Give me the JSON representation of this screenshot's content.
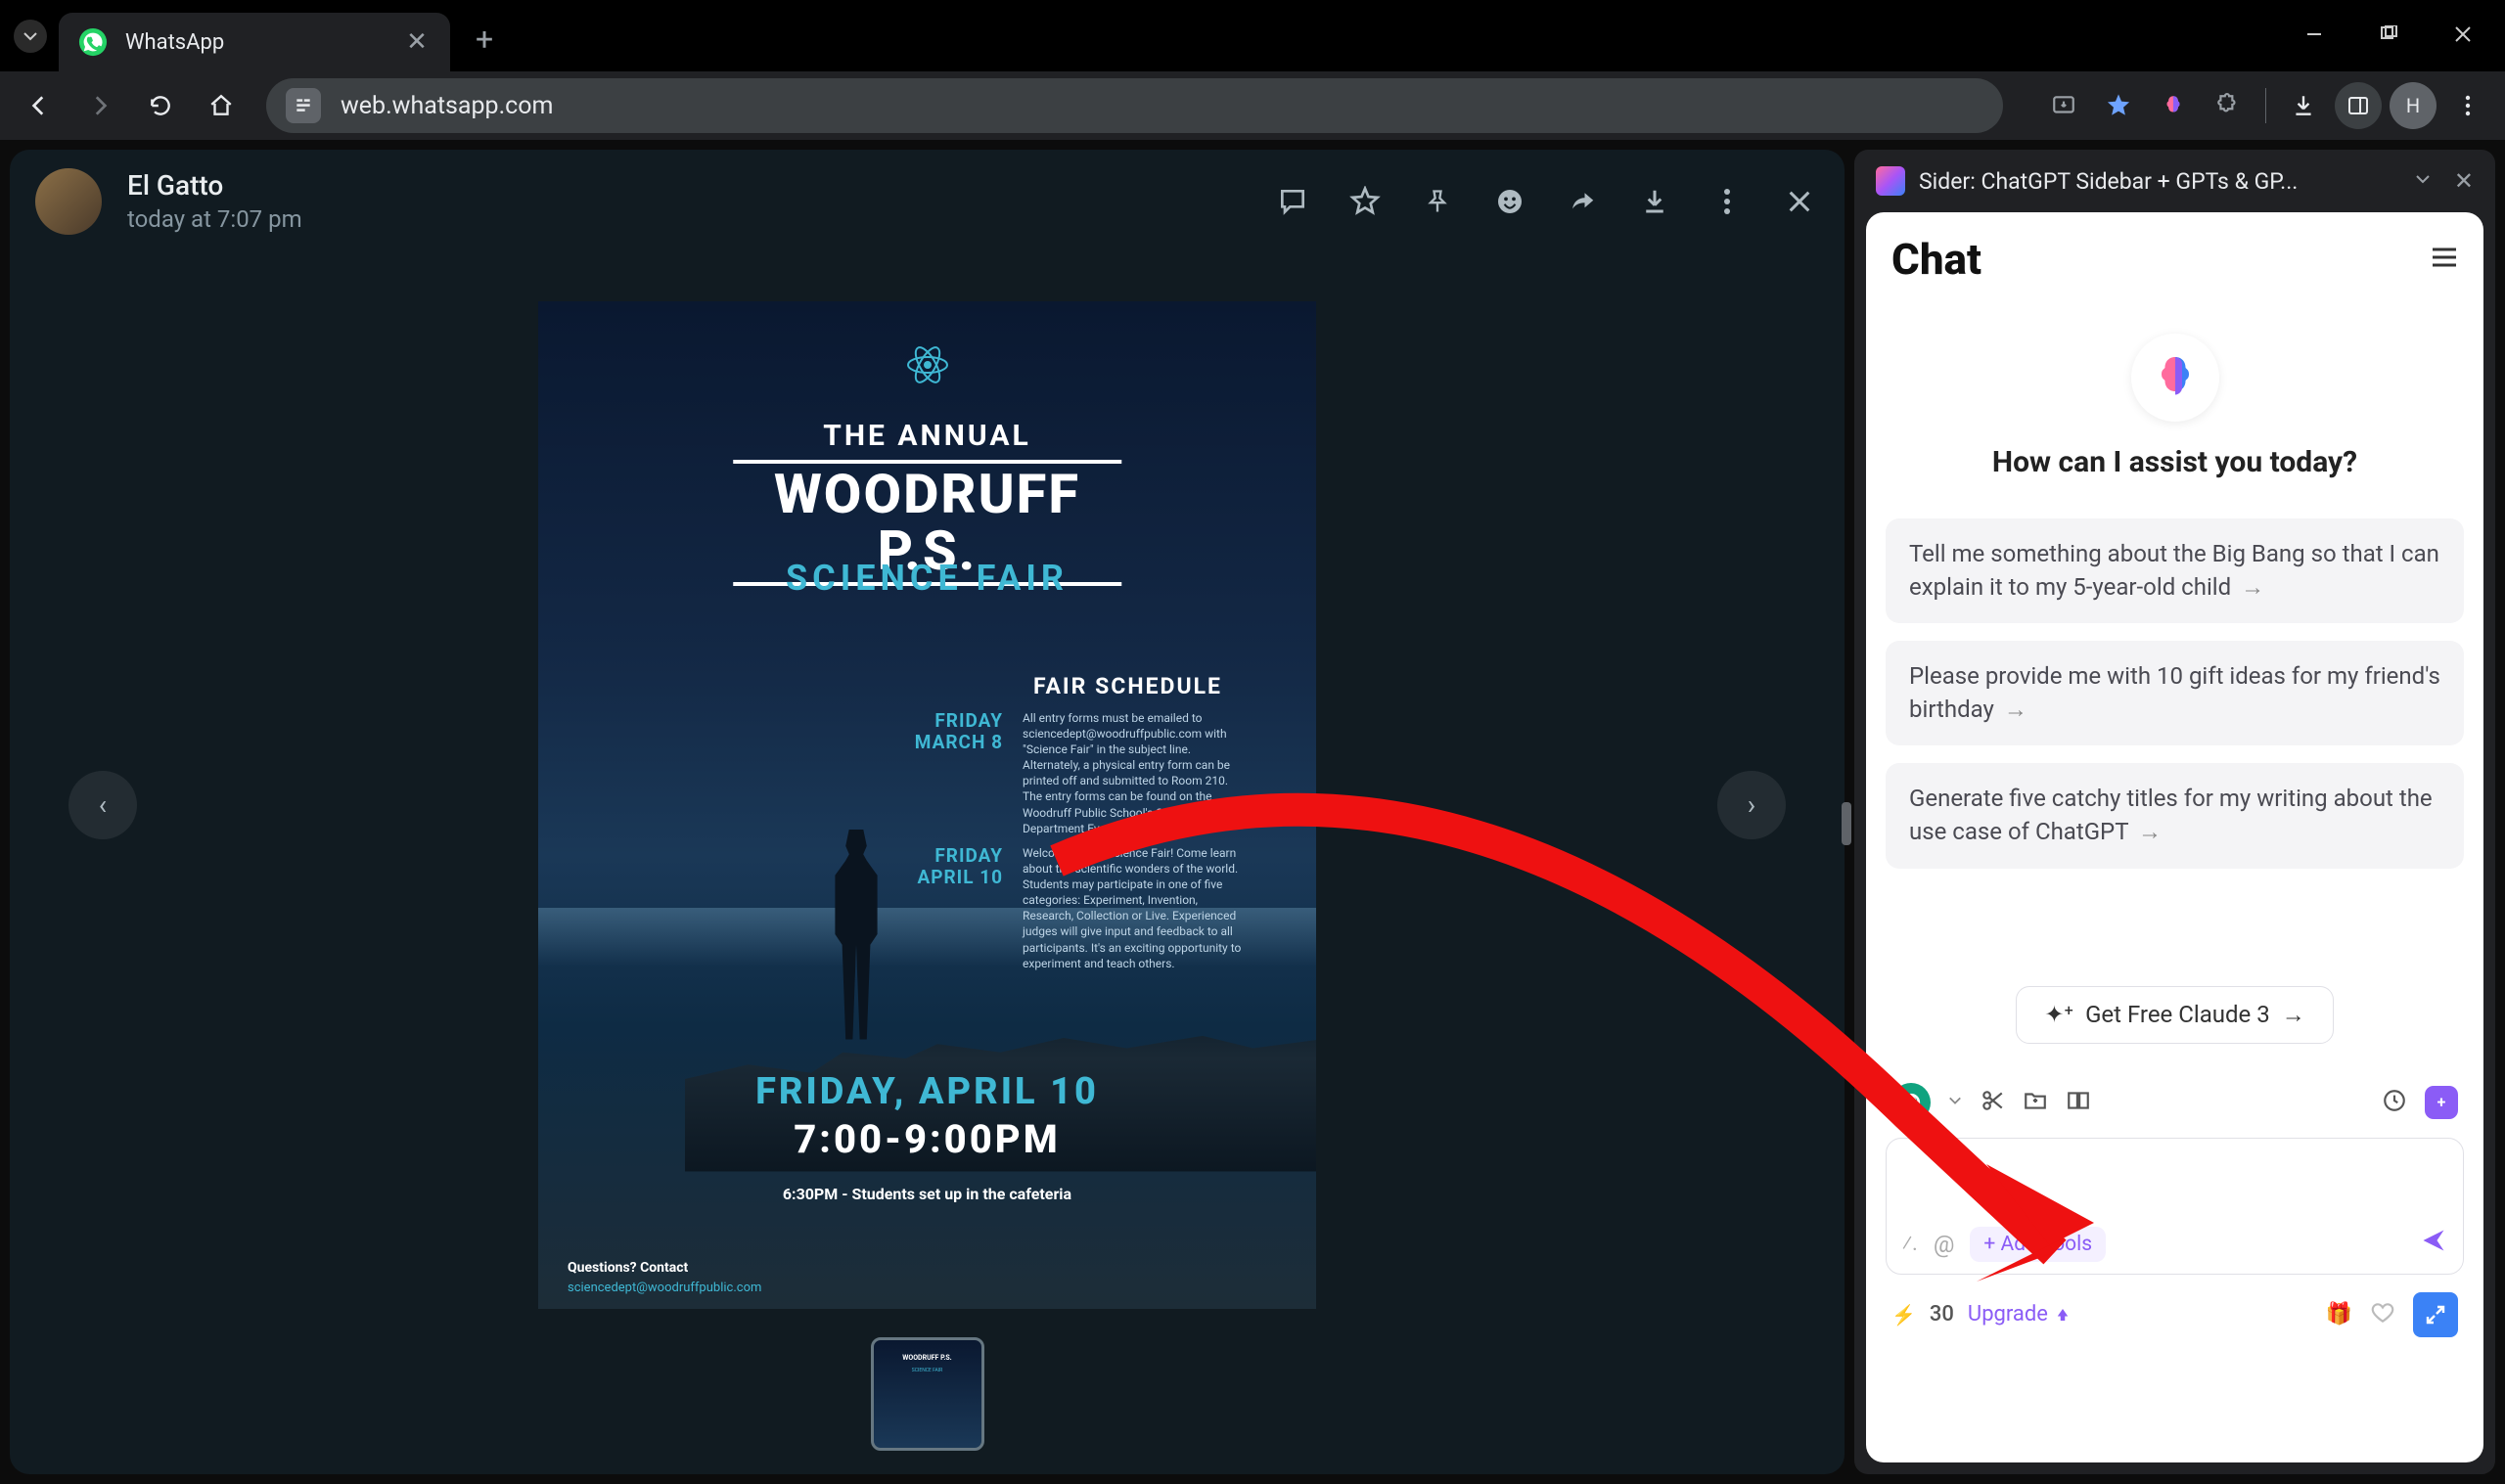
{
  "browser": {
    "tab_title": "WhatsApp",
    "url": "web.whatsapp.com",
    "avatar_letter": "H"
  },
  "whatsapp": {
    "contact_name": "El Gatto",
    "contact_time": "today at 7:07 pm"
  },
  "poster": {
    "pretitle": "THE ANNUAL",
    "title": "WOODRUFF P.S.",
    "subtitle": "SCIENCE FAIR",
    "schedule_heading": "FAIR SCHEDULE",
    "date1_line1": "FRIDAY",
    "date1_line2": "MARCH 8",
    "body1": "All entry forms must be emailed to sciencedept@woodruffpublic.com with \"Science Fair\" in the subject line. Alternately, a physical entry form can be printed off and submitted to Room 210. The entry forms can be found on the Woodruff Public School's Science Department Events Page.",
    "date2_line1": "FRIDAY",
    "date2_line2": "APRIL 10",
    "body2": "Welcome to the Science Fair! Come learn about the scientific wonders of the world. Students may participate in one of five categories: Experiment, Invention, Research, Collection or Live. Experienced judges will give input and feedback to all participants. It's an exciting opportunity to experiment and teach others.",
    "main_date": "FRIDAY, APRIL 10",
    "main_time": "7:00-9:00PM",
    "setup_line": "6:30PM - Students set up in the cafeteria",
    "footer_q": "Questions? Contact",
    "footer_email": "sciencedept@woodruffpublic.com"
  },
  "sider": {
    "title": "Sider: ChatGPT Sidebar + GPTs & GP...",
    "chat_label": "Chat",
    "welcome": "How can I assist you today?",
    "suggestions": [
      "Tell me something about the Big Bang so that I can explain it to my 5-year-old child",
      "Please provide me with 10 gift ideas for my friend's birthday",
      "Generate five catchy titles for my writing about the use case of ChatGPT"
    ],
    "claude_pill": "Get Free Claude 3",
    "add_tools": "+ Add Tools",
    "credits": "30",
    "upgrade": "Upgrade"
  }
}
